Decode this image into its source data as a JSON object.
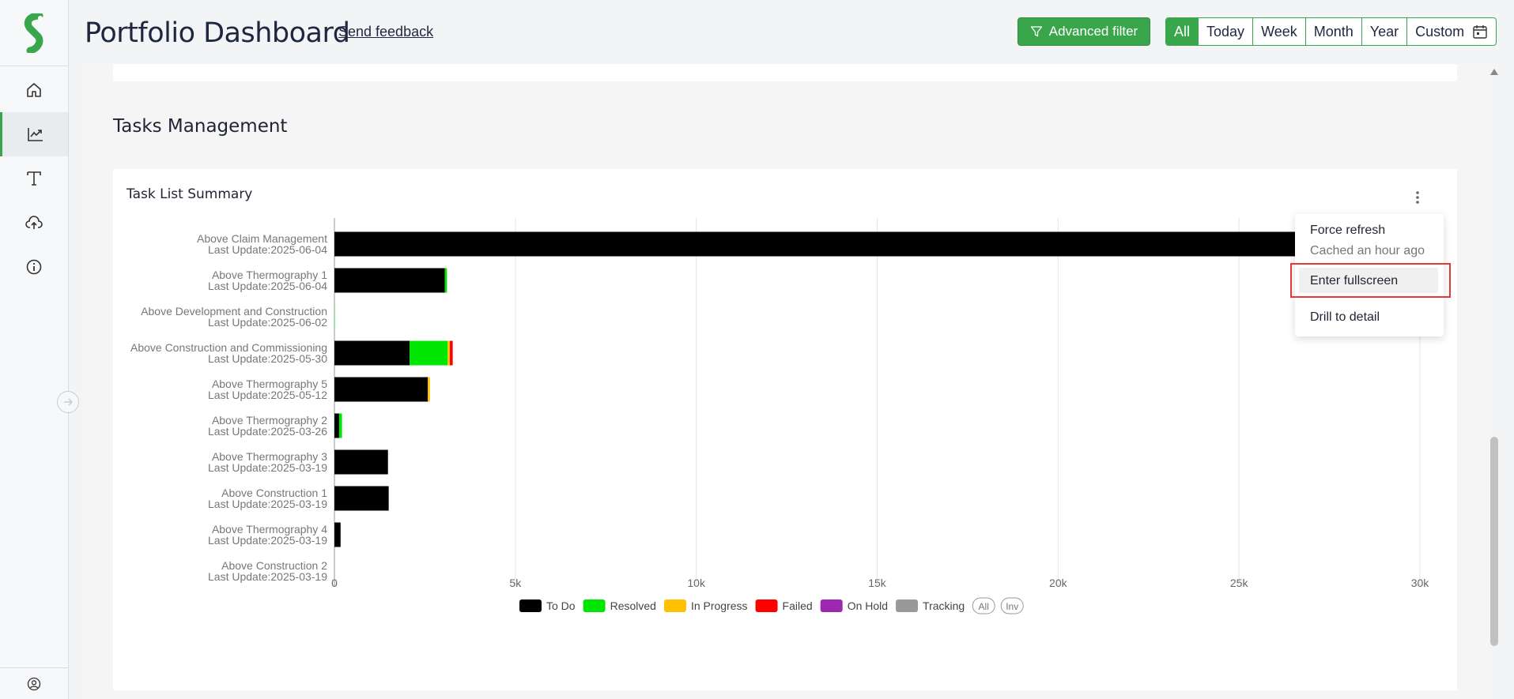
{
  "header": {
    "title": "Portfolio Dashboard",
    "feedback_link": "Send feedback",
    "advanced_filter_label": "Advanced filter",
    "time_ranges": [
      "All",
      "Today",
      "Week",
      "Month",
      "Year",
      "Custom"
    ],
    "active_range": "All"
  },
  "sidebar": {
    "items": [
      {
        "icon": "home-icon"
      },
      {
        "icon": "chart-trend-icon",
        "active": true
      },
      {
        "icon": "text-format-icon"
      },
      {
        "icon": "cloud-upload-icon"
      },
      {
        "icon": "info-icon"
      }
    ],
    "bottom_icon": "user-icon"
  },
  "section": {
    "title": "Tasks Management"
  },
  "card": {
    "title": "Task List Summary"
  },
  "menu": {
    "force_refresh": "Force refresh",
    "cached": "Cached an hour ago",
    "fullscreen": "Enter fullscreen",
    "drill": "Drill to detail"
  },
  "colors": {
    "accent": "#3aa64b",
    "todo": "#000000",
    "resolved": "#00e600",
    "in_progress": "#ffc000",
    "failed": "#ff0000",
    "on_hold": "#9c27b0",
    "tracking": "#999999"
  },
  "chart_data": {
    "type": "bar",
    "orientation": "horizontal",
    "stacked": true,
    "categories": [
      "Above Claim Management|Last Update:2025-06-04",
      "Above Thermography 1|Last Update:2025-06-04",
      "Above Development and Construction|Last Update:2025-06-02",
      "Above Construction and Commissioning|Last Update:2025-05-30",
      "Above Thermography 5|Last Update:2025-05-12",
      "Above Thermography 2|Last Update:2025-03-26",
      "Above Thermography 3|Last Update:2025-03-19",
      "Above Construction 1|Last Update:2025-03-19",
      "Above Thermography 4|Last Update:2025-03-19",
      "Above Construction 2|Last Update:2025-03-19"
    ],
    "series": [
      {
        "name": "To Do",
        "color": "#000000",
        "values": [
          26800,
          3050,
          0,
          2080,
          2580,
          130,
          1480,
          1500,
          170,
          0
        ]
      },
      {
        "name": "Resolved",
        "color": "#00e600",
        "values": [
          0,
          60,
          10,
          1050,
          0,
          80,
          0,
          0,
          0,
          0
        ]
      },
      {
        "name": "In Progress",
        "color": "#ffc000",
        "values": [
          0,
          0,
          0,
          60,
          60,
          0,
          0,
          0,
          0,
          0
        ]
      },
      {
        "name": "Failed",
        "color": "#ff0000",
        "values": [
          0,
          0,
          0,
          80,
          0,
          0,
          0,
          0,
          0,
          0
        ]
      },
      {
        "name": "On Hold",
        "color": "#9c27b0",
        "values": [
          0,
          0,
          0,
          0,
          0,
          0,
          0,
          0,
          0,
          0
        ]
      },
      {
        "name": "Tracking",
        "color": "#999999",
        "values": [
          0,
          0,
          0,
          0,
          0,
          0,
          0,
          0,
          0,
          0
        ]
      }
    ],
    "xticks": [
      "0",
      "5k",
      "10k",
      "15k",
      "20k",
      "25k",
      "30k"
    ],
    "xlim": [
      0,
      30000
    ],
    "grid": true,
    "legend_position": "bottom",
    "legend_extra": [
      "All",
      "Inv"
    ]
  }
}
